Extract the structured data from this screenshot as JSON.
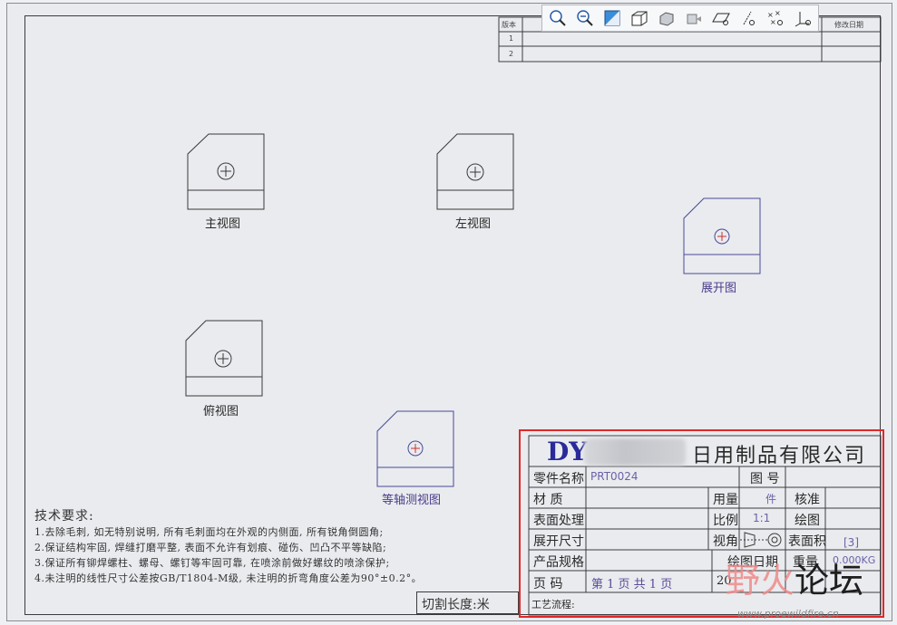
{
  "toolbar": {
    "buttons": [
      {
        "name": "zoom-in-icon"
      },
      {
        "name": "zoom-out-icon"
      },
      {
        "name": "refit-icon"
      },
      {
        "name": "display-style-icon"
      },
      {
        "name": "saved-views-icon"
      },
      {
        "name": "named-view-icon"
      },
      {
        "name": "datum-plane-icon"
      },
      {
        "name": "datum-axis-icon"
      },
      {
        "name": "datum-point-icon"
      },
      {
        "name": "coordinate-system-icon"
      }
    ]
  },
  "revision_table": {
    "header_left": "版本",
    "header_right": "修改日期",
    "rows": [
      "1",
      "2"
    ]
  },
  "views": {
    "main": "主视图",
    "left": "左视图",
    "unfold": "展开图",
    "top": "俯视图",
    "iso": "等轴测视图"
  },
  "tech": {
    "title": "技术要求:",
    "lines": [
      "1.去除毛刺, 如无特别说明, 所有毛刺面均在外观的内侧面, 所有锐角倒圆角;",
      "2.保证结构牢固, 焊缝打磨平整, 表面不允许有划痕、碰伤、凹凸不平等缺陷;",
      "3.保证所有铆焊螺柱、螺母、螺钉等牢固可靠, 在喷涂前做好螺纹的喷涂保护;",
      "4.未注明的线性尺寸公差按GB/T1804-M级, 未注明的折弯角度公差为90°±0.2°。"
    ]
  },
  "cut_length": "切割长度:米",
  "title_block": {
    "logo": "DY",
    "company_suffix": "日用制品有限公司",
    "part_name_label": "零件名称",
    "part_name_value": "PRT0024",
    "drawing_no_label": "图  号",
    "material_label": "材    质",
    "usage_label": "用量",
    "usage_value": "件",
    "check_label": "核准",
    "surface_label": "表面处理",
    "scale_label": "比例",
    "scale_value": "1:1",
    "draw_label": "绘图",
    "unfold_label": "展开尺寸",
    "view_angle_label": "视角",
    "area_label": "表面积",
    "area_value": "[3]",
    "spec_label": "产品规格",
    "draw_date_label": "绘图日期",
    "weight_label": "重量",
    "weight_value": "0.000KG",
    "page_label": "页    码",
    "page_value": "第 1 页   共 1 页",
    "date_value": "20",
    "process_label": "工艺流程:"
  },
  "watermark": {
    "text_colored": "野火",
    "text_dark": "论坛",
    "url": "www.proewildfire.cn"
  }
}
